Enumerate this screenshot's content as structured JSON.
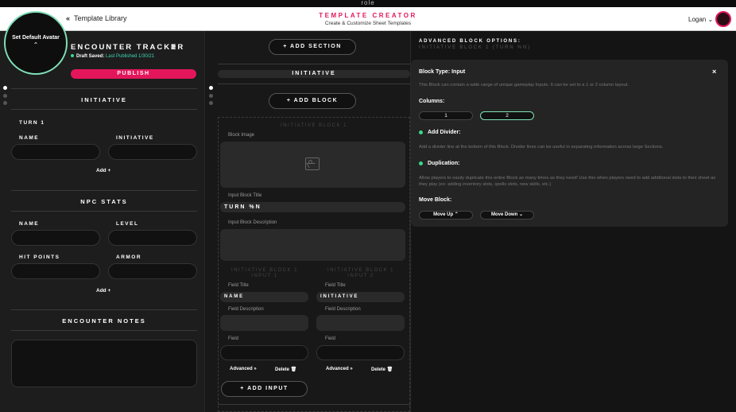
{
  "topstrip": {
    "brand": "role"
  },
  "header": {
    "back_icon": "double-chevron-left-icon",
    "library_label": "Template Library",
    "title": "TEMPLATE CREATOR",
    "subtitle": "Create & Customize Sheet Templates",
    "user": "Logan",
    "user_chevron": "⌄"
  },
  "left": {
    "avatar_label": "Set Default Avatar",
    "avatar_icon": "⌃",
    "title": "ENCOUNTER TRACKER",
    "draft_label": "Draft Saved:",
    "published": "Last Published 1/30/21",
    "publish_button": "PUBLISH",
    "sections": {
      "initiative": "INITIATIVE",
      "turn": "TURN 1",
      "name_label": "NAME",
      "initiative_label": "INITIATIVE",
      "add1": "Add +",
      "npc": "NPC STATS",
      "npc_name": "NAME",
      "npc_level": "LEVEL",
      "hit_points": "HIT POINTS",
      "armor": "ARMOR",
      "add2": "Add +",
      "notes": "ENCOUNTER NOTES"
    }
  },
  "middle": {
    "add_section": "+ ADD SECTION",
    "initiative_bar": "INITIATIVE",
    "add_block": "+ ADD BLOCK",
    "block_ghost": "INITIATIVE BLOCK 1",
    "block_image_label": "Block Image",
    "input_block_title_label": "Input Block Title",
    "input_block_title_value": "TURN %N",
    "input_block_desc_label": "Input Block Description",
    "input1_ghost": "INITIATIVE BLOCK 1 INPUT 1",
    "input2_ghost": "INITIATIVE BLOCK 1 INPUT 2",
    "field_title_label": "Field Title",
    "field_title_1": "NAME",
    "field_title_2": "INITIATIVE",
    "field_desc_label": "Field Description",
    "field_label": "Field",
    "advanced": "Advanced »",
    "delete": "Delete 🗑",
    "add_input": "+ ADD INPUT"
  },
  "right": {
    "adv_heading": "ADVANCED BLOCK OPTIONS:",
    "adv_sub": "INITIATIVE BLOCK 1 (TURN %N)",
    "block_type": "Block Type: Input",
    "close": "×",
    "block_desc": "This Block can contain a wide range of unique gameplay Inputs. It can be set to a 1 or 2 column layout.",
    "columns_label": "Columns:",
    "col1": "1",
    "col2": "2",
    "divider_label": "Add Divider:",
    "divider_desc": "Add a divider line at the bottom of this Block. Divider lines can be useful in separating information across large Sections.",
    "dup_label": "Duplication:",
    "dup_desc": "Allow players to easily duplicate this entire Block as many times as they need! Use this when players need to add additional slots to their sheet as they play (ex: adding inventory slots, spells slots, new skills, etc.)",
    "move_label": "Move Block:",
    "move_up": "Move Up ⌃",
    "move_down": "Move Down ⌄",
    "accent_color": "#7fe0b8"
  },
  "colors": {
    "brand": "#e3165b",
    "status_green": "#39d98a"
  }
}
